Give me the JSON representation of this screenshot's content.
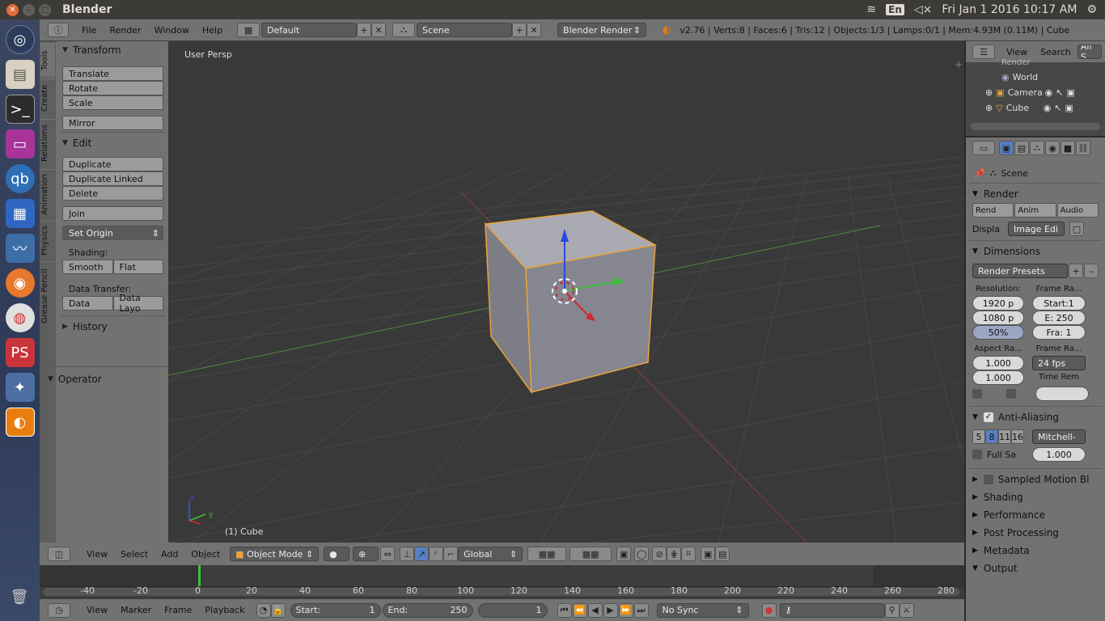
{
  "window": {
    "title": "Blender"
  },
  "tray": {
    "lang": "En",
    "datetime": "Fri Jan  1 2016 10:17 AM"
  },
  "menubar": {
    "menus": [
      "File",
      "Render",
      "Window",
      "Help"
    ],
    "layout": "Default",
    "scene": "Scene",
    "engine": "Blender Render",
    "stats": "v2.76 | Verts:8 | Faces:6 | Tris:12 | Objects:1/3 | Lamps:0/1 | Mem:4.93M (0.11M) | Cube"
  },
  "toolshelf": {
    "tabs": [
      "Tools",
      "Create",
      "Relations",
      "Animation",
      "Physics",
      "Grease Pencil"
    ],
    "transform": {
      "title": "Transform",
      "buttons": [
        "Translate",
        "Rotate",
        "Scale",
        "Mirror"
      ]
    },
    "edit": {
      "title": "Edit",
      "buttons": [
        "Duplicate",
        "Duplicate Linked",
        "Delete",
        "Join"
      ],
      "set_origin": "Set Origin",
      "shading_label": "Shading:",
      "smooth": "Smooth",
      "flat": "Flat",
      "transfer_label": "Data Transfer:",
      "data": "Data",
      "data_layo": "Data Layo"
    },
    "history": "History",
    "operator": "Operator"
  },
  "viewport": {
    "title": "User Persp",
    "object": "(1) Cube"
  },
  "view3d_header": {
    "menus": [
      "View",
      "Select",
      "Add",
      "Object"
    ],
    "mode": "Object Mode",
    "orientation": "Global"
  },
  "timeline": {
    "ticks": [
      "-40",
      "-20",
      "0",
      "20",
      "40",
      "60",
      "80",
      "100",
      "120",
      "140",
      "160",
      "180",
      "200",
      "220",
      "240",
      "260",
      "280"
    ],
    "menus": [
      "View",
      "Marker",
      "Frame",
      "Playback"
    ],
    "start_label": "Start:",
    "start": "1",
    "end_label": "End:",
    "end": "250",
    "current": "1",
    "sync": "No Sync"
  },
  "outliner": {
    "menus": [
      "View",
      "Search"
    ],
    "filter": "All S",
    "items": [
      "Render",
      "World",
      "Camera",
      "Cube"
    ]
  },
  "properties": {
    "context": "Scene",
    "render": {
      "title": "Render",
      "rend": "Rend",
      "anim": "Anim",
      "audio": "Audio",
      "display_label": "Displa",
      "display": "Image Edi"
    },
    "dimensions": {
      "title": "Dimensions",
      "presets": "Render Presets",
      "resolution": "Resolution:",
      "frame_range": "Frame Ra...",
      "resx": "1920 p",
      "resy": "1080 p",
      "pct": "50%",
      "start": "Start:1",
      "end": "E: 250",
      "fra": "Fra:  1",
      "aspect": "Aspect Ra...",
      "frame_rate": "Frame Ra...",
      "ax": "1.000",
      "ay": "1.000",
      "fps": "24 fps",
      "time_rem": "Time Rem"
    },
    "aa": {
      "title": "Anti-Aliasing",
      "samples": [
        "5",
        "8",
        "11",
        "16"
      ],
      "filter": "Mitchell-",
      "full": "Full Sa",
      "size": "1.000"
    },
    "collapsed": [
      "Sampled Motion Blu",
      "Shading",
      "Performance",
      "Post Processing",
      "Metadata",
      "Output"
    ]
  }
}
